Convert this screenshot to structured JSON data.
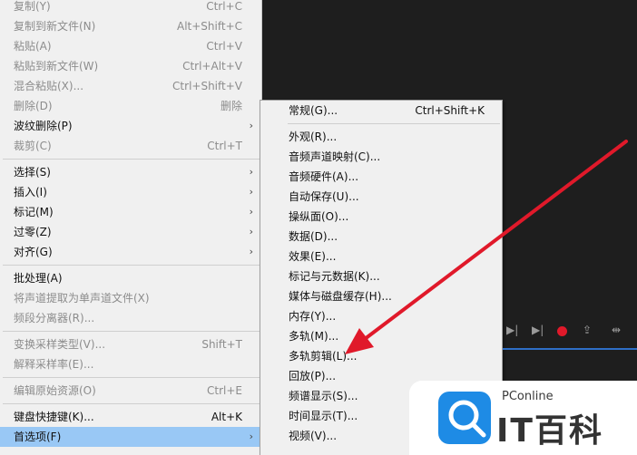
{
  "main_menu": {
    "items": [
      {
        "label": "复制(Y)",
        "shortcut": "Ctrl+C",
        "disabled": true
      },
      {
        "label": "复制到新文件(N)",
        "shortcut": "Alt+Shift+C",
        "disabled": true
      },
      {
        "label": "粘贴(A)",
        "shortcut": "Ctrl+V",
        "disabled": true
      },
      {
        "label": "粘贴到新文件(W)",
        "shortcut": "Ctrl+Alt+V",
        "disabled": true
      },
      {
        "label": "混合粘贴(X)...",
        "shortcut": "Ctrl+Shift+V",
        "disabled": true
      },
      {
        "label": "删除(D)",
        "shortcut": "删除",
        "disabled": true
      },
      {
        "label": "波纹删除(P)",
        "has_submenu": true,
        "disabled": false
      },
      {
        "label": "裁剪(C)",
        "shortcut": "Ctrl+T",
        "disabled": true
      },
      {
        "separator": true
      },
      {
        "label": "选择(S)",
        "has_submenu": true
      },
      {
        "label": "插入(I)",
        "has_submenu": true
      },
      {
        "label": "标记(M)",
        "has_submenu": true
      },
      {
        "label": "过零(Z)",
        "has_submenu": true
      },
      {
        "label": "对齐(G)",
        "has_submenu": true
      },
      {
        "separator": true
      },
      {
        "label": "批处理(A)"
      },
      {
        "label": "将声道提取为单声道文件(X)",
        "disabled": true
      },
      {
        "label": "频段分离器(R)...",
        "disabled": true
      },
      {
        "separator": true
      },
      {
        "label": "变换采样类型(V)...",
        "shortcut": "Shift+T",
        "disabled": true
      },
      {
        "label": "解释采样率(E)...",
        "disabled": true
      },
      {
        "separator": true
      },
      {
        "label": "编辑原始资源(O)",
        "shortcut": "Ctrl+E",
        "disabled": true
      },
      {
        "separator": true
      },
      {
        "label": "键盘快捷键(K)...",
        "shortcut": "Alt+K"
      },
      {
        "label": "首选项(F)",
        "has_submenu": true,
        "highlight": true
      }
    ]
  },
  "sub_menu": {
    "items": [
      {
        "label": "常规(G)...",
        "shortcut": "Ctrl+Shift+K"
      },
      {
        "separator": true
      },
      {
        "label": "外观(R)..."
      },
      {
        "label": "音频声道映射(C)..."
      },
      {
        "label": "音频硬件(A)..."
      },
      {
        "label": "自动保存(U)..."
      },
      {
        "label": "操纵面(O)..."
      },
      {
        "label": "数据(D)..."
      },
      {
        "label": "效果(E)..."
      },
      {
        "label": "标记与元数据(K)..."
      },
      {
        "label": "媒体与磁盘缓存(H)..."
      },
      {
        "label": "内存(Y)..."
      },
      {
        "label": "多轨(M)..."
      },
      {
        "label": "多轨剪辑(L)..."
      },
      {
        "label": "回放(P)..."
      },
      {
        "label": "频谱显示(S)..."
      },
      {
        "label": "时间显示(T)..."
      },
      {
        "label": "视频(V)..."
      }
    ]
  },
  "transport": {
    "icons": [
      "skip-back-icon",
      "skip-forward-icon",
      "record-icon",
      "loop-icon",
      "ripple-icon"
    ],
    "record_color": "#e0192a"
  },
  "watermark": {
    "brand": "PConline",
    "title": "IT百科",
    "accent": "#1e8be5"
  },
  "annotation": {
    "arrow_color": "#e0192a"
  }
}
